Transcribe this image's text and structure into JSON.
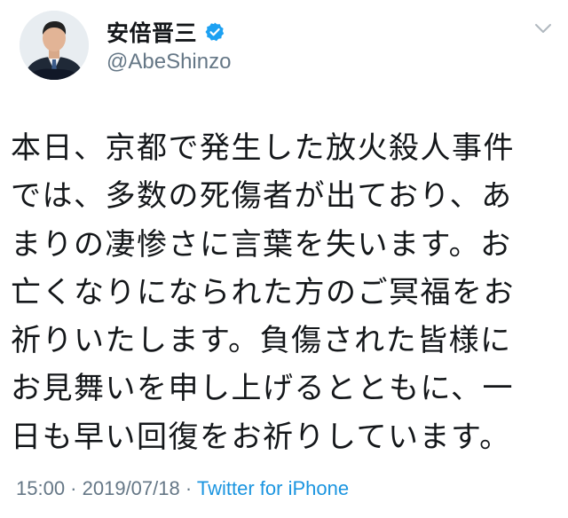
{
  "author": {
    "display_name": "安倍晋三",
    "handle": "@AbeShinzo",
    "verified_icon": "verified-badge-icon",
    "avatar_icon": "profile-photo"
  },
  "tweet": {
    "text": "本日、京都で発生した放火殺人事件\nでは、多数の死傷者が出ており、あ\nまりの凄惨さに言葉を失います。お\n亡くなりになられた方のご冥福をお\n祈りいたします。負傷された皆様に\nお見舞いを申し上げるとともに、一\n日も早い回復をお祈りしています。"
  },
  "meta": {
    "time": "15:00",
    "separator_1": " · ",
    "date": "2019/07/18",
    "separator_2": " · ",
    "source": "Twitter for iPhone"
  },
  "menu": {
    "icon": "chevron-down-icon"
  },
  "colors": {
    "text": "#14171a",
    "secondary": "#657786",
    "link": "#1b95e0",
    "verified": "#1da1f2",
    "background": "#ffffff"
  }
}
